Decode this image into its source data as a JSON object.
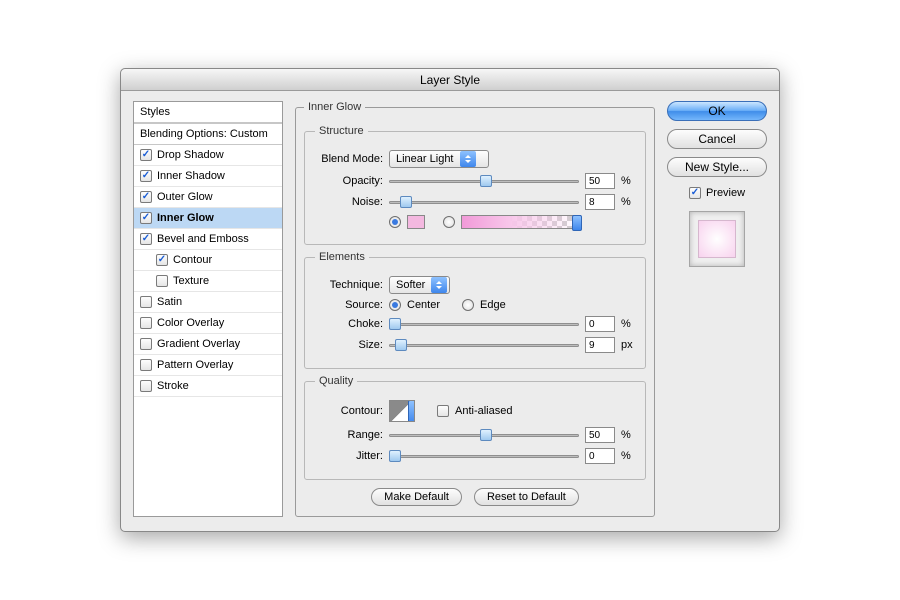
{
  "title": "Layer Style",
  "sidebar": {
    "header": "Styles",
    "blending": "Blending Options: Custom",
    "items": [
      {
        "label": "Drop Shadow",
        "checked": true
      },
      {
        "label": "Inner Shadow",
        "checked": true
      },
      {
        "label": "Outer Glow",
        "checked": true
      },
      {
        "label": "Inner Glow",
        "checked": true,
        "selected": true
      },
      {
        "label": "Bevel and Emboss",
        "checked": true
      },
      {
        "label": "Contour",
        "checked": true,
        "indent": true
      },
      {
        "label": "Texture",
        "checked": false,
        "indent": true
      },
      {
        "label": "Satin",
        "checked": false
      },
      {
        "label": "Color Overlay",
        "checked": false
      },
      {
        "label": "Gradient Overlay",
        "checked": false
      },
      {
        "label": "Pattern Overlay",
        "checked": false
      },
      {
        "label": "Stroke",
        "checked": false
      }
    ]
  },
  "panel": {
    "title": "Inner Glow",
    "structure": {
      "title": "Structure",
      "blend_mode_label": "Blend Mode:",
      "blend_mode": "Linear Light",
      "opacity_label": "Opacity:",
      "opacity": "50",
      "opacity_unit": "%",
      "noise_label": "Noise:",
      "noise": "8",
      "noise_unit": "%",
      "color_selected": true,
      "color": "#f4b8e0"
    },
    "elements": {
      "title": "Elements",
      "technique_label": "Technique:",
      "technique": "Softer",
      "source_label": "Source:",
      "source_center": "Center",
      "source_edge": "Edge",
      "source": "center",
      "choke_label": "Choke:",
      "choke": "0",
      "choke_unit": "%",
      "size_label": "Size:",
      "size": "9",
      "size_unit": "px"
    },
    "quality": {
      "title": "Quality",
      "contour_label": "Contour:",
      "antialias_label": "Anti-aliased",
      "antialias": false,
      "range_label": "Range:",
      "range": "50",
      "range_unit": "%",
      "jitter_label": "Jitter:",
      "jitter": "0",
      "jitter_unit": "%"
    },
    "make_default": "Make Default",
    "reset_default": "Reset to Default"
  },
  "buttons": {
    "ok": "OK",
    "cancel": "Cancel",
    "new_style": "New Style...",
    "preview": "Preview"
  }
}
